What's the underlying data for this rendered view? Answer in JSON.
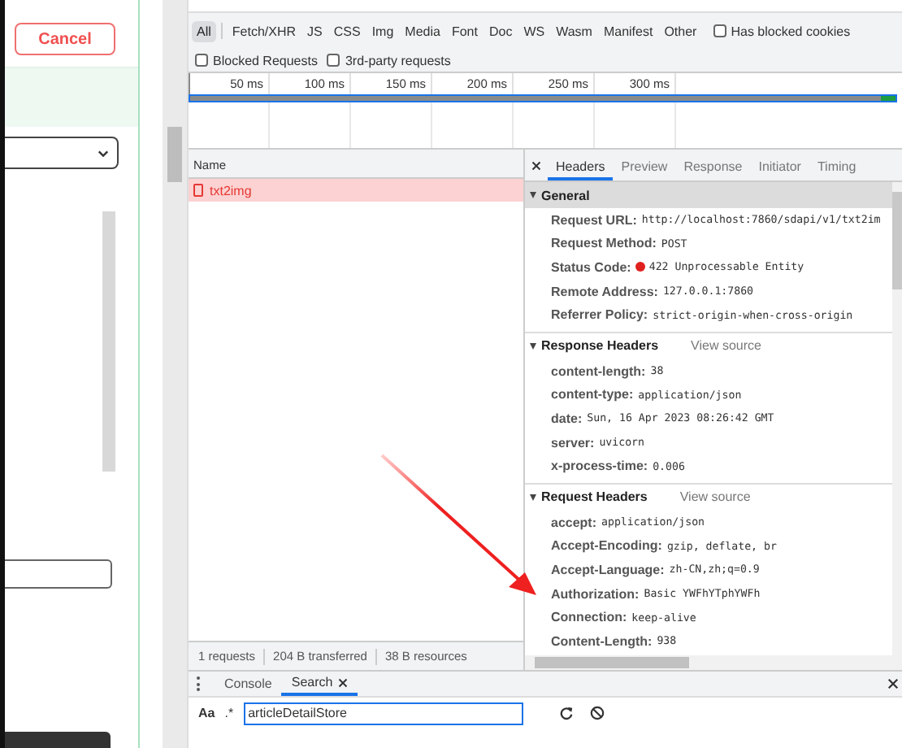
{
  "page": {
    "cancel_button": "Cancel"
  },
  "network": {
    "type_filters": [
      {
        "label": "All",
        "selected": true
      },
      {
        "label": "Fetch/XHR",
        "selected": false
      },
      {
        "label": "JS",
        "selected": false
      },
      {
        "label": "CSS",
        "selected": false
      },
      {
        "label": "Img",
        "selected": false
      },
      {
        "label": "Media",
        "selected": false
      },
      {
        "label": "Font",
        "selected": false
      },
      {
        "label": "Doc",
        "selected": false
      },
      {
        "label": "WS",
        "selected": false
      },
      {
        "label": "Wasm",
        "selected": false
      },
      {
        "label": "Manifest",
        "selected": false
      },
      {
        "label": "Other",
        "selected": false
      }
    ],
    "filter_checkboxes": [
      {
        "label": "Has blocked cookies",
        "checked": false
      }
    ],
    "checkboxes": [
      {
        "label": "Blocked Requests",
        "checked": false
      },
      {
        "label": "3rd-party requests",
        "checked": false
      }
    ],
    "timeline_ticks": [
      "50 ms",
      "100 ms",
      "150 ms",
      "200 ms",
      "250 ms",
      "300 ms"
    ],
    "requests": {
      "column": "Name",
      "rows": [
        {
          "name": "txt2img",
          "selected": true,
          "error": true
        }
      ]
    },
    "summary": [
      "1 requests",
      "204 B transferred",
      "38 B resources"
    ],
    "detail_tabs": [
      {
        "label": "Headers",
        "selected": true
      },
      {
        "label": "Preview",
        "selected": false
      },
      {
        "label": "Response",
        "selected": false
      },
      {
        "label": "Initiator",
        "selected": false
      },
      {
        "label": "Timing",
        "selected": false
      }
    ],
    "sections": [
      {
        "title": "General",
        "expanded": true,
        "rows": [
          {
            "key": "Request URL:",
            "value": "http://localhost:7860/sdapi/v1/txt2im"
          },
          {
            "key": "Request Method:",
            "value": "POST"
          },
          {
            "key": "Status Code:",
            "value": "422 Unprocessable Entity",
            "kind": "status"
          },
          {
            "key": "Remote Address:",
            "value": "127.0.0.1:7860"
          },
          {
            "key": "Referrer Policy:",
            "value": "strict-origin-when-cross-origin"
          }
        ]
      },
      {
        "title": "Response Headers",
        "expanded": true,
        "link": "View source",
        "rows": [
          {
            "key": "content-length:",
            "value": "38"
          },
          {
            "key": "content-type:",
            "value": "application/json"
          },
          {
            "key": "date:",
            "value": "Sun, 16 Apr 2023 08:26:42 GMT"
          },
          {
            "key": "server:",
            "value": "uvicorn"
          },
          {
            "key": "x-process-time:",
            "value": "0.006"
          }
        ]
      },
      {
        "title": "Request Headers",
        "expanded": true,
        "link": "View source",
        "rows": [
          {
            "key": "accept:",
            "value": "application/json"
          },
          {
            "key": "Accept-Encoding:",
            "value": "gzip, deflate, br"
          },
          {
            "key": "Accept-Language:",
            "value": "zh-CN,zh;q=0.9"
          },
          {
            "key": "Authorization:",
            "value": "Basic YWFhYTphYWFh"
          },
          {
            "key": "Connection:",
            "value": "keep-alive"
          },
          {
            "key": "Content-Length:",
            "value": "938"
          }
        ]
      }
    ]
  },
  "drawer": {
    "tabs": [
      {
        "label": "Console",
        "selected": false,
        "closable": false
      },
      {
        "label": "Search",
        "selected": true,
        "closable": true
      }
    ],
    "case_toggle": "Aa",
    "regex_toggle": ".*",
    "search_value": "articleDetailStore"
  }
}
